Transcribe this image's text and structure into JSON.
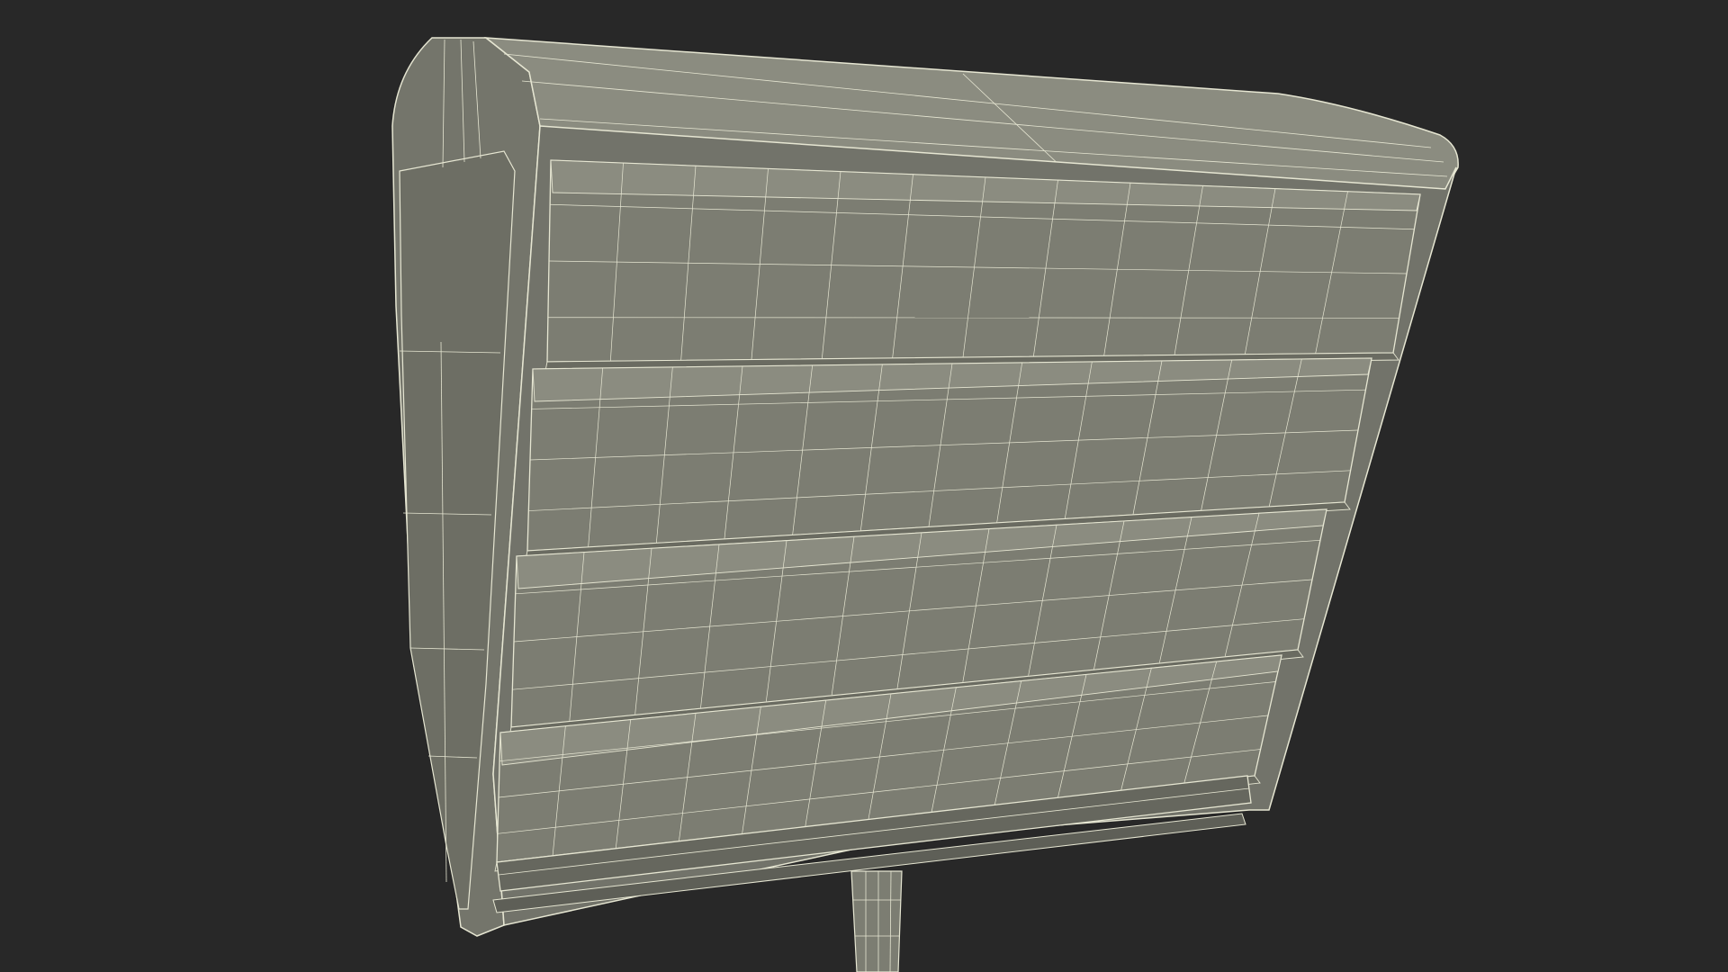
{
  "viewport": {
    "background_color": "#282828",
    "subject": "wireframe-render",
    "model_fill_color": "#7c7d72",
    "model_shadow_color": "#6a6b61",
    "model_highlight_color": "#8b8c80",
    "wire_color": "#e6e6d2",
    "louver_count": 4,
    "louver_vertical_divisions": 12
  }
}
